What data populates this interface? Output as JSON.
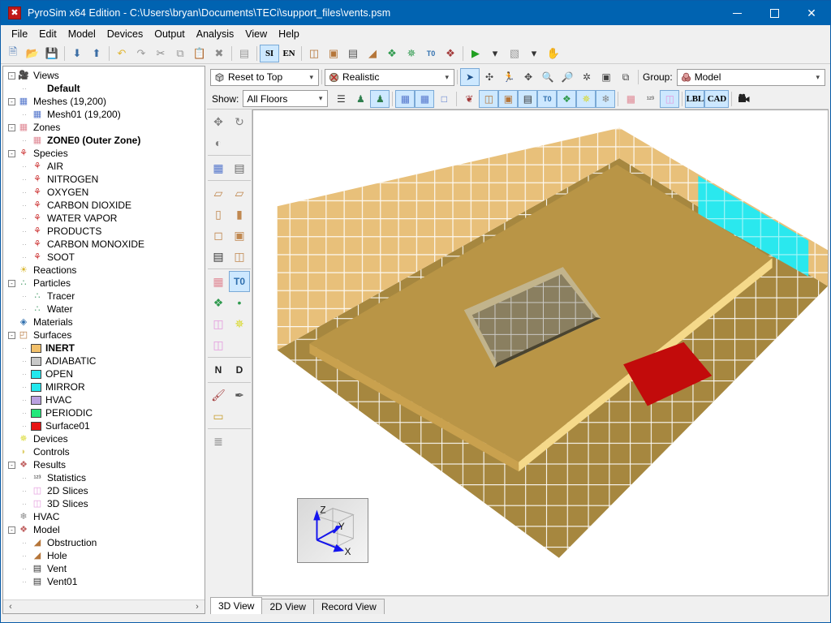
{
  "window": {
    "title": "PyroSim x64 Edition - C:\\Users\\bryan\\Documents\\TECi\\support_files\\vents.psm",
    "app_icon": "pyrosim-icon",
    "minimize": "–",
    "maximize": "□",
    "close": "✕",
    "titlebar_color": "#0063b1"
  },
  "menu": {
    "items": [
      {
        "label": "File"
      },
      {
        "label": "Edit"
      },
      {
        "label": "Model"
      },
      {
        "label": "Devices"
      },
      {
        "label": "Output"
      },
      {
        "label": "Analysis"
      },
      {
        "label": "View"
      },
      {
        "label": "Help"
      }
    ]
  },
  "toolbar": {
    "buttons": [
      {
        "name": "new-file",
        "glyph": "🗎",
        "color": "#4a79b5"
      },
      {
        "name": "open-file",
        "glyph": "📂",
        "color": "#d39b2a"
      },
      {
        "name": "save-file",
        "glyph": "💾",
        "color": "#5a7fae"
      },
      {
        "sep": true
      },
      {
        "name": "import",
        "glyph": "⬇",
        "color": "#3c6ea5"
      },
      {
        "name": "export",
        "glyph": "⬆",
        "color": "#3c6ea5"
      },
      {
        "sep": true
      },
      {
        "name": "undo",
        "glyph": "↶",
        "color": "#e0b636"
      },
      {
        "name": "redo",
        "glyph": "↷",
        "color": "#9a9a9a"
      },
      {
        "name": "cut",
        "glyph": "✂",
        "color": "#8a8a8a"
      },
      {
        "name": "copy",
        "glyph": "⧉",
        "color": "#9a9a9a"
      },
      {
        "name": "paste",
        "glyph": "📋",
        "color": "#b08a52"
      },
      {
        "name": "delete",
        "glyph": "✖",
        "color": "#8a8a8a"
      },
      {
        "sep": true
      },
      {
        "name": "edit-properties",
        "glyph": "▤",
        "color": "#9a9a9a"
      },
      {
        "sep": true
      }
    ],
    "units_si": "SI",
    "units_en": "EN",
    "units_active": "SI",
    "model_buttons": [
      {
        "name": "new-obstruction",
        "glyph": "◫",
        "color": "#b5763a"
      },
      {
        "name": "new-hole",
        "glyph": "▣",
        "color": "#b5763a"
      },
      {
        "name": "new-vent",
        "glyph": "▤",
        "color": "#555555"
      },
      {
        "name": "new-surface",
        "glyph": "◢",
        "color": "#b5763a"
      },
      {
        "name": "new-particle",
        "glyph": "❖",
        "color": "#2f9a4e"
      },
      {
        "name": "new-device",
        "glyph": "✵",
        "color": "#2f9a4e"
      },
      {
        "name": "new-label",
        "glyph": "T0",
        "color": "#2f6fae"
      },
      {
        "name": "new-group",
        "glyph": "❖",
        "color": "#a33a3a"
      },
      {
        "sep": true
      },
      {
        "name": "run-simulation",
        "glyph": "▶",
        "color": "#22a022"
      },
      {
        "name": "run-dropdown",
        "glyph": "▾",
        "color": "#333333"
      },
      {
        "name": "show-results",
        "glyph": "▧",
        "color": "#9a9a9a"
      },
      {
        "name": "results-dropdown",
        "glyph": "▾",
        "color": "#333333"
      },
      {
        "name": "stop",
        "glyph": "✋",
        "color": "#8a8a8a"
      }
    ]
  },
  "tree": {
    "nodes": [
      {
        "depth": 0,
        "exp": "-",
        "icon": "camera-icon",
        "glyph": "🎥",
        "color": "#333333",
        "label": "Views",
        "bold": false
      },
      {
        "depth": 1,
        "exp": "",
        "icon": "view-default-icon",
        "glyph": "",
        "color": "#333333",
        "label": "Default",
        "bold": true
      },
      {
        "depth": 0,
        "exp": "-",
        "icon": "mesh-icon",
        "glyph": "▦",
        "color": "#5577cc",
        "label": "Meshes (19,200)",
        "bold": false
      },
      {
        "depth": 1,
        "exp": "",
        "icon": "mesh-icon",
        "glyph": "▦",
        "color": "#5577cc",
        "label": "Mesh01 (19,200)",
        "bold": false
      },
      {
        "depth": 0,
        "exp": "-",
        "icon": "zone-icon",
        "glyph": "▦",
        "color": "#e08a96",
        "label": "Zones",
        "bold": false
      },
      {
        "depth": 1,
        "exp": "",
        "icon": "zone-icon",
        "glyph": "▦",
        "color": "#e08a96",
        "label": "ZONE0 (Outer Zone)",
        "bold": true
      },
      {
        "depth": 0,
        "exp": "-",
        "icon": "species-icon",
        "glyph": "⚘",
        "color": "#cc3333",
        "label": "Species",
        "bold": false
      },
      {
        "depth": 1,
        "exp": "",
        "icon": "species-icon",
        "glyph": "⚘",
        "color": "#cc3333",
        "label": "AIR",
        "bold": false
      },
      {
        "depth": 1,
        "exp": "",
        "icon": "species-icon",
        "glyph": "⚘",
        "color": "#cc3333",
        "label": "NITROGEN",
        "bold": false
      },
      {
        "depth": 1,
        "exp": "",
        "icon": "species-icon",
        "glyph": "⚘",
        "color": "#cc3333",
        "label": "OXYGEN",
        "bold": false
      },
      {
        "depth": 1,
        "exp": "",
        "icon": "species-icon",
        "glyph": "⚘",
        "color": "#cc3333",
        "label": "CARBON DIOXIDE",
        "bold": false
      },
      {
        "depth": 1,
        "exp": "",
        "icon": "species-icon",
        "glyph": "⚘",
        "color": "#cc3333",
        "label": "WATER VAPOR",
        "bold": false
      },
      {
        "depth": 1,
        "exp": "",
        "icon": "species-icon",
        "glyph": "⚘",
        "color": "#cc3333",
        "label": "PRODUCTS",
        "bold": false
      },
      {
        "depth": 1,
        "exp": "",
        "icon": "species-icon",
        "glyph": "⚘",
        "color": "#cc3333",
        "label": "CARBON MONOXIDE",
        "bold": false
      },
      {
        "depth": 1,
        "exp": "",
        "icon": "species-icon",
        "glyph": "⚘",
        "color": "#cc3333",
        "label": "SOOT",
        "bold": false
      },
      {
        "depth": 0,
        "exp": "",
        "icon": "reactions-icon",
        "glyph": "☀",
        "color": "#d8b52a",
        "label": "Reactions",
        "bold": false
      },
      {
        "depth": 0,
        "exp": "-",
        "icon": "particles-icon",
        "glyph": "∴",
        "color": "#4f9f6f",
        "label": "Particles",
        "bold": false
      },
      {
        "depth": 1,
        "exp": "",
        "icon": "particles-icon",
        "glyph": "∴",
        "color": "#4f9f6f",
        "label": "Tracer",
        "bold": false
      },
      {
        "depth": 1,
        "exp": "",
        "icon": "particles-icon",
        "glyph": "∴",
        "color": "#4f9f6f",
        "label": "Water",
        "bold": false
      },
      {
        "depth": 0,
        "exp": "",
        "icon": "materials-icon",
        "glyph": "◈",
        "color": "#2f6fae",
        "label": "Materials",
        "bold": false
      },
      {
        "depth": 0,
        "exp": "-",
        "icon": "surfaces-icon",
        "glyph": "◰",
        "color": "#b5763a",
        "label": "Surfaces",
        "bold": false
      },
      {
        "depth": 1,
        "exp": "",
        "icon": "surface-swatch",
        "swatch": "#f2c06a",
        "label": "INERT",
        "bold": true
      },
      {
        "depth": 1,
        "exp": "",
        "icon": "surface-swatch",
        "swatch": "#c8c8c8",
        "label": "ADIABATIC",
        "bold": false
      },
      {
        "depth": 1,
        "exp": "",
        "icon": "surface-swatch",
        "swatch": "#22e8ee",
        "label": "OPEN",
        "bold": false
      },
      {
        "depth": 1,
        "exp": "",
        "icon": "surface-swatch",
        "swatch": "#22e8ee",
        "label": "MIRROR",
        "bold": false
      },
      {
        "depth": 1,
        "exp": "",
        "icon": "surface-swatch",
        "swatch": "#b9a0e0",
        "label": "HVAC",
        "bold": false
      },
      {
        "depth": 1,
        "exp": "",
        "icon": "surface-swatch",
        "swatch": "#22e87a",
        "label": "PERIODIC",
        "bold": false
      },
      {
        "depth": 1,
        "exp": "",
        "icon": "surface-swatch",
        "swatch": "#e81414",
        "label": "Surface01",
        "bold": false
      },
      {
        "depth": 0,
        "exp": "",
        "icon": "devices-icon",
        "glyph": "✵",
        "color": "#d8d82a",
        "label": "Devices",
        "bold": false
      },
      {
        "depth": 0,
        "exp": "",
        "icon": "controls-icon",
        "glyph": "◗",
        "color": "#e0d070",
        "label": "Controls",
        "bold": false
      },
      {
        "depth": 0,
        "exp": "-",
        "icon": "results-icon",
        "glyph": "❖",
        "color": "#c06060",
        "label": "Results",
        "bold": false
      },
      {
        "depth": 1,
        "exp": "",
        "icon": "statistics-icon",
        "glyph": "¹²³",
        "color": "#333333",
        "label": "Statistics",
        "bold": false
      },
      {
        "depth": 1,
        "exp": "",
        "icon": "slice-icon",
        "glyph": "◫",
        "color": "#e49ade",
        "label": "2D Slices",
        "bold": false
      },
      {
        "depth": 1,
        "exp": "",
        "icon": "slice-icon",
        "glyph": "◫",
        "color": "#e49ade",
        "label": "3D Slices",
        "bold": false
      },
      {
        "depth": 0,
        "exp": "",
        "icon": "hvac-icon",
        "glyph": "❄",
        "color": "#888888",
        "label": "HVAC",
        "bold": false
      },
      {
        "depth": 0,
        "exp": "-",
        "icon": "model-icon",
        "glyph": "❖",
        "color": "#c06060",
        "label": "Model",
        "bold": false
      },
      {
        "depth": 1,
        "exp": "",
        "icon": "obstruction-icon",
        "glyph": "◢",
        "color": "#b5763a",
        "label": "Obstruction",
        "bold": false
      },
      {
        "depth": 1,
        "exp": "",
        "icon": "hole-icon",
        "glyph": "◢",
        "color": "#b5763a",
        "label": "Hole",
        "bold": false
      },
      {
        "depth": 1,
        "exp": "",
        "icon": "vent-icon",
        "glyph": "▤",
        "color": "#333333",
        "label": "Vent",
        "bold": false
      },
      {
        "depth": 1,
        "exp": "",
        "icon": "vent-icon",
        "glyph": "▤",
        "color": "#333333",
        "label": "Vent01",
        "bold": false
      }
    ],
    "scroll_left": "‹",
    "scroll_right": "›"
  },
  "viewtoolbar": {
    "reset_view": {
      "label": "Reset to Top",
      "icon": "cube-icon"
    },
    "render_mode": {
      "label": "Realistic",
      "icon": "render-icon"
    },
    "nav_buttons": [
      {
        "name": "select-tool",
        "glyph": "➤",
        "active": true
      },
      {
        "name": "orbit-tool",
        "glyph": "✣",
        "active": false
      },
      {
        "name": "walk-tool",
        "glyph": "🏃",
        "active": false
      },
      {
        "name": "pan-tool",
        "glyph": "✥",
        "active": false
      },
      {
        "name": "zoom-tool",
        "glyph": "🔍",
        "active": false
      },
      {
        "name": "zoom-region-tool",
        "glyph": "🔎",
        "active": false
      },
      {
        "name": "center-tool",
        "glyph": "✲",
        "active": false
      },
      {
        "name": "fit-tool",
        "glyph": "▣",
        "active": false
      },
      {
        "name": "zoom-selection-tool",
        "glyph": "⧉",
        "active": false
      }
    ],
    "group_label": "Group:",
    "group_value": "Model",
    "group_icon": "model-icon"
  },
  "viewtoolbar2": {
    "show_label": "Show:",
    "floors_value": "All Floors",
    "buttons": [
      {
        "name": "floor-levels",
        "glyph": "☰",
        "active": false,
        "color": "#333333"
      },
      {
        "name": "show-person-1",
        "glyph": "♟",
        "active": false,
        "color": "#2f7f4f"
      },
      {
        "name": "show-person-2",
        "glyph": "♟",
        "active": true,
        "color": "#2f7f4f"
      },
      {
        "sep": true
      },
      {
        "name": "show-mesh-outline",
        "glyph": "▦",
        "active": true,
        "color": "#5577cc"
      },
      {
        "name": "show-mesh-grid",
        "glyph": "▦",
        "active": true,
        "color": "#5577cc"
      },
      {
        "name": "show-mesh-wire",
        "glyph": "□",
        "active": false,
        "color": "#5577cc"
      },
      {
        "sep": true
      },
      {
        "name": "show-reactions",
        "glyph": "❦",
        "active": false,
        "color": "#a33a3a"
      },
      {
        "name": "show-obstructions",
        "glyph": "◫",
        "active": true,
        "color": "#b5763a"
      },
      {
        "name": "show-holes",
        "glyph": "▣",
        "active": true,
        "color": "#b5763a"
      },
      {
        "name": "show-vents",
        "glyph": "▤",
        "active": true,
        "color": "#333333"
      },
      {
        "name": "show-labels",
        "glyph": "T0",
        "active": true,
        "color": "#2f6fae"
      },
      {
        "name": "show-particles",
        "glyph": "❖",
        "active": true,
        "color": "#2f9a4e"
      },
      {
        "name": "show-devices",
        "glyph": "✵",
        "active": true,
        "color": "#d8d82a"
      },
      {
        "name": "show-hvac",
        "glyph": "❄",
        "active": true,
        "color": "#888888"
      },
      {
        "sep": true
      },
      {
        "name": "show-zones",
        "glyph": "▦",
        "active": false,
        "color": "#e08a96"
      },
      {
        "name": "show-statistics",
        "glyph": "¹²³",
        "active": false,
        "color": "#333333"
      },
      {
        "name": "show-slices",
        "glyph": "◫",
        "active": true,
        "color": "#e49ade"
      },
      {
        "sep": true
      }
    ],
    "lbl_button": "LBL",
    "cad_button": "CAD",
    "camera_button": {
      "name": "camera-icon",
      "glyph": "🎥"
    }
  },
  "vtoolbar": {
    "buttons": [
      {
        "name": "move-tool",
        "glyph": "✥",
        "color": "#808080",
        "active": false
      },
      {
        "name": "rotate-tool",
        "glyph": "↻",
        "color": "#808080",
        "active": false
      },
      {
        "name": "mirror-tool",
        "glyph": "◐",
        "color": "#808080",
        "active": false
      },
      {
        "grp": true
      },
      {
        "name": "new-mesh",
        "glyph": "▦",
        "color": "#5577cc",
        "active": false
      },
      {
        "name": "mesh-table",
        "glyph": "▤",
        "color": "#666666",
        "active": false
      },
      {
        "grp": true
      },
      {
        "name": "new-slab",
        "glyph": "▱",
        "color": "#c08850",
        "active": false
      },
      {
        "name": "new-plate",
        "glyph": "▱",
        "color": "#c08850",
        "active": false
      },
      {
        "name": "new-wall",
        "glyph": "▯",
        "color": "#c08850",
        "active": false
      },
      {
        "name": "new-column",
        "glyph": "▮",
        "color": "#c08850",
        "active": false
      },
      {
        "name": "new-box",
        "glyph": "◻",
        "color": "#c08850",
        "active": false
      },
      {
        "name": "new-frame",
        "glyph": "▣",
        "color": "#c08850",
        "active": false
      },
      {
        "name": "new-vent-tool",
        "glyph": "▤",
        "color": "#333333",
        "active": false
      },
      {
        "name": "new-obstruction-tool",
        "glyph": "◫",
        "color": "#c08850",
        "active": false
      },
      {
        "grp": true
      },
      {
        "name": "new-zone-tool",
        "glyph": "▦",
        "color": "#e08a96",
        "active": false
      },
      {
        "name": "new-label-tool",
        "glyph": "T0",
        "color": "#2f6fae",
        "active": true
      },
      {
        "name": "new-particle-tool",
        "glyph": "❖",
        "color": "#2f9a4e",
        "active": false
      },
      {
        "name": "new-particle-single",
        "glyph": "•",
        "color": "#2f9a4e",
        "active": false
      },
      {
        "name": "new-slice-tool",
        "glyph": "◫",
        "color": "#e49ade",
        "active": false
      },
      {
        "name": "new-device-tool",
        "glyph": "✵",
        "color": "#d8d82a",
        "active": false
      },
      {
        "name": "new-3d-slice-tool",
        "glyph": "◫",
        "color": "#e49ade",
        "active": false
      },
      {
        "grp": true
      },
      {
        "name": "normal-tool",
        "glyph": "N",
        "color": "#222222",
        "active": false
      },
      {
        "name": "direction-tool",
        "glyph": "D",
        "color": "#222222",
        "active": false
      },
      {
        "grp": true
      },
      {
        "name": "paint-tool",
        "glyph": "🖌",
        "color": "#a33a3a",
        "active": false
      },
      {
        "name": "eyedropper-tool",
        "glyph": "✒",
        "color": "#555555",
        "active": false
      },
      {
        "name": "measure-tool",
        "glyph": "▭",
        "color": "#c8a030",
        "active": false
      },
      {
        "grp": true
      },
      {
        "name": "list-tool",
        "glyph": "≣",
        "color": "#777777",
        "active": false
      }
    ]
  },
  "axis_gizmo": {
    "x_label": "X",
    "y_label": "Y",
    "z_label": "Z",
    "axis_color": "#1414ee"
  },
  "scene": {
    "wall_color": "#e8c07a",
    "floor_color": "#b3924a",
    "slab_top_color": "#c9a14e",
    "slab_edge_color": "#f5d98a",
    "mesh_line_color": "#ffffff",
    "hole_color": "#8a7f60",
    "vent_open_color": "#2ae8ee",
    "vent_surface01_color": "#c20b0b",
    "background": "#ffffff"
  },
  "tabs": {
    "items": [
      {
        "label": "3D View",
        "active": true
      },
      {
        "label": "2D View",
        "active": false
      },
      {
        "label": "Record View",
        "active": false
      }
    ]
  }
}
